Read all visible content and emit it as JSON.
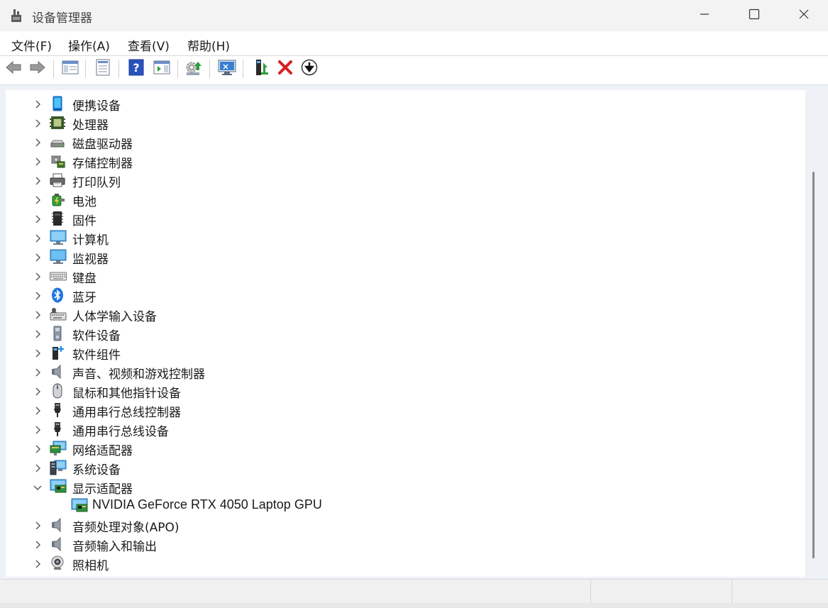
{
  "window": {
    "title": "设备管理器",
    "controls": [
      "minimize-icon",
      "maximize-icon",
      "close-icon"
    ]
  },
  "menu": [
    "文件(F)",
    "操作(A)",
    "查看(V)",
    "帮助(H)"
  ],
  "toolbar": {
    "buttons": [
      "back-arrow-icon",
      "forward-arrow-icon",
      "show-hide-console-tree-icon",
      "properties-icon",
      "help-icon",
      "action-pane-icon",
      "update-driver-icon",
      "scan-hardware-icon",
      "enable-device-icon",
      "uninstall-device-icon",
      "disable-device-icon"
    ],
    "accent_red": "#d81e1e",
    "accent_green": "#2e9e3e"
  },
  "tree": {
    "items": [
      {
        "label": "便携设备",
        "icon": "portable-device-icon",
        "expanded": false
      },
      {
        "label": "处理器",
        "icon": "processor-icon",
        "expanded": false
      },
      {
        "label": "磁盘驱动器",
        "icon": "disk-drive-icon",
        "expanded": false
      },
      {
        "label": "存储控制器",
        "icon": "storage-controller-icon",
        "expanded": false
      },
      {
        "label": "打印队列",
        "icon": "printer-icon",
        "expanded": false
      },
      {
        "label": "电池",
        "icon": "battery-icon",
        "expanded": false
      },
      {
        "label": "固件",
        "icon": "firmware-icon",
        "expanded": false
      },
      {
        "label": "计算机",
        "icon": "computer-icon",
        "expanded": false
      },
      {
        "label": "监视器",
        "icon": "monitor-icon",
        "expanded": false
      },
      {
        "label": "键盘",
        "icon": "keyboard-icon",
        "expanded": false
      },
      {
        "label": "蓝牙",
        "icon": "bluetooth-icon",
        "expanded": false
      },
      {
        "label": "人体学输入设备",
        "icon": "hid-icon",
        "expanded": false
      },
      {
        "label": "软件设备",
        "icon": "software-device-icon",
        "expanded": false
      },
      {
        "label": "软件组件",
        "icon": "software-component-icon",
        "expanded": false
      },
      {
        "label": "声音、视频和游戏控制器",
        "icon": "speaker-icon",
        "expanded": false
      },
      {
        "label": "鼠标和其他指针设备",
        "icon": "mouse-icon",
        "expanded": false
      },
      {
        "label": "通用串行总线控制器",
        "icon": "usb-icon",
        "expanded": false
      },
      {
        "label": "通用串行总线设备",
        "icon": "usb-icon",
        "expanded": false
      },
      {
        "label": "网络适配器",
        "icon": "network-adapter-icon",
        "expanded": false
      },
      {
        "label": "系统设备",
        "icon": "system-device-icon",
        "expanded": false
      },
      {
        "label": "显示适配器",
        "icon": "display-adapter-icon",
        "expanded": true,
        "children": [
          {
            "label": "NVIDIA GeForce RTX 4050 Laptop GPU",
            "icon": "display-adapter-icon"
          }
        ]
      },
      {
        "label": "音频处理对象(APO)",
        "icon": "speaker-icon",
        "expanded": false
      },
      {
        "label": "音频输入和输出",
        "icon": "speaker-icon",
        "expanded": false
      },
      {
        "label": "照相机",
        "icon": "camera-icon",
        "expanded": false
      }
    ]
  },
  "scroll": {
    "position_fraction": 0.17,
    "visible_fraction": 0.79
  }
}
